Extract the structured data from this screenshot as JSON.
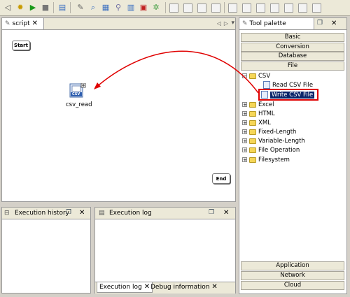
{
  "script_tab": {
    "title": "script"
  },
  "nodes": {
    "start": "Start",
    "end": "End",
    "csv_read": "csv_read",
    "csv_badge": "CSV"
  },
  "palette": {
    "title": "Tool palette",
    "top_categories": [
      "Basic",
      "Conversion",
      "Database",
      "File"
    ],
    "bottom_categories": [
      "Application",
      "Network",
      "Cloud"
    ],
    "tree": {
      "csv_folder": "CSV",
      "read_csv": "Read CSV File",
      "write_csv": "Write CSV File",
      "folders": [
        "Excel",
        "HTML",
        "XML",
        "Fixed-Length",
        "Variable-Length",
        "File Operation",
        "Filesystem"
      ]
    }
  },
  "history": {
    "title": "Execution history"
  },
  "log": {
    "title": "Execution log",
    "bottom_tabs": [
      "Execution log",
      "Debug information"
    ]
  },
  "colors": {
    "arrow": "#e00000",
    "highlight_border": "#e00000",
    "selection": "#0a246a"
  }
}
